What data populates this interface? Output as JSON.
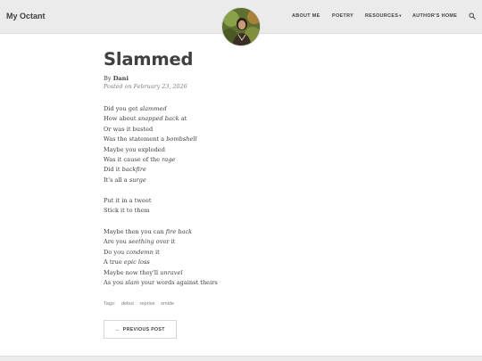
{
  "header": {
    "site_title": "My Octant",
    "nav": [
      {
        "label": "ABOUT ME"
      },
      {
        "label": "POETRY"
      },
      {
        "label": "RESOURCES",
        "dropdown": true
      },
      {
        "label": "AUTHOR'S HOME"
      }
    ],
    "search_icon": "search-icon"
  },
  "post": {
    "title": "Slammed",
    "by_prefix": "By",
    "author": "Dani",
    "posted": "Posted on February 23, 2026"
  },
  "poem": {
    "stanza1": [
      {
        "a": "Did you get ",
        "b": "slammed",
        "c": ""
      },
      {
        "a": "How about ",
        "b": "snapped back",
        "c": " at"
      },
      {
        "a": "Or was it busted",
        "b": "",
        "c": ""
      },
      {
        "a": "Was the statement a ",
        "b": "bombshell",
        "c": ""
      },
      {
        "a": "Maybe you exploded",
        "b": "",
        "c": ""
      },
      {
        "a": "Was it cause of the ",
        "b": "rage",
        "c": ""
      },
      {
        "a": "Did it ",
        "b": "backfire",
        "c": ""
      },
      {
        "a": "It's all a ",
        "b": "surge",
        "c": ""
      }
    ],
    "stanza2": [
      {
        "a": "Put it in a tweet",
        "b": "",
        "c": ""
      },
      {
        "a": "Stick it to them",
        "b": "",
        "c": ""
      }
    ],
    "stanza3": [
      {
        "a": "Maybe then you can ",
        "b": "fire back",
        "c": ""
      },
      {
        "a": "Are you ",
        "b": "seething",
        "c": " over it"
      },
      {
        "a": "Do you ",
        "b": "condemn",
        "c": " it"
      },
      {
        "a": "A true ",
        "b": "epic loss",
        "c": ""
      },
      {
        "a": "Maybe now they'll ",
        "b": "unravel",
        "c": ""
      },
      {
        "a": "As you ",
        "b": "slam",
        "c": " your words against theirs"
      }
    ]
  },
  "tags": {
    "label": "Tags:",
    "items": [
      "debut",
      "reprise",
      "smide"
    ]
  },
  "navigation": {
    "prev_arrow": "←",
    "prev_label": "PREVIOUS POST"
  }
}
